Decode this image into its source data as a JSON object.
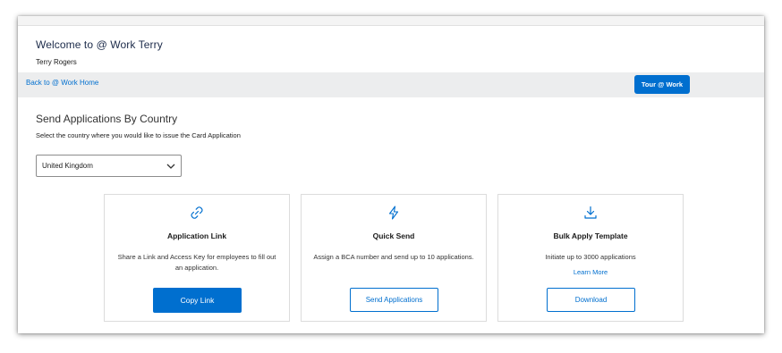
{
  "header": {
    "welcome": "Welcome to @ Work Terry",
    "user_name": "Terry Rogers"
  },
  "nav": {
    "back_link": "Back to @ Work Home",
    "tour_button": "Tour @ Work"
  },
  "country_section": {
    "title": "Send Applications By Country",
    "subtitle": "Select the country where you would like to issue the Card Application",
    "selected_country": "United Kingdom"
  },
  "cards": [
    {
      "icon": "link-icon",
      "title": "Application Link",
      "description": "Share a Link and Access Key for employees to fill out an application.",
      "button_label": "Copy Link"
    },
    {
      "icon": "lightning-icon",
      "title": "Quick Send",
      "description": "Assign a BCA number and send up to 10 applications.",
      "button_label": "Send Applications"
    },
    {
      "icon": "download-icon",
      "title": "Bulk Apply Template",
      "description": "Initiate up to 3000 applications",
      "link_label": "Learn More",
      "button_label": "Download"
    }
  ],
  "colors": {
    "accent": "#006fcf",
    "navbar_bg": "#ecedee",
    "heading": "#1c2b4a"
  }
}
